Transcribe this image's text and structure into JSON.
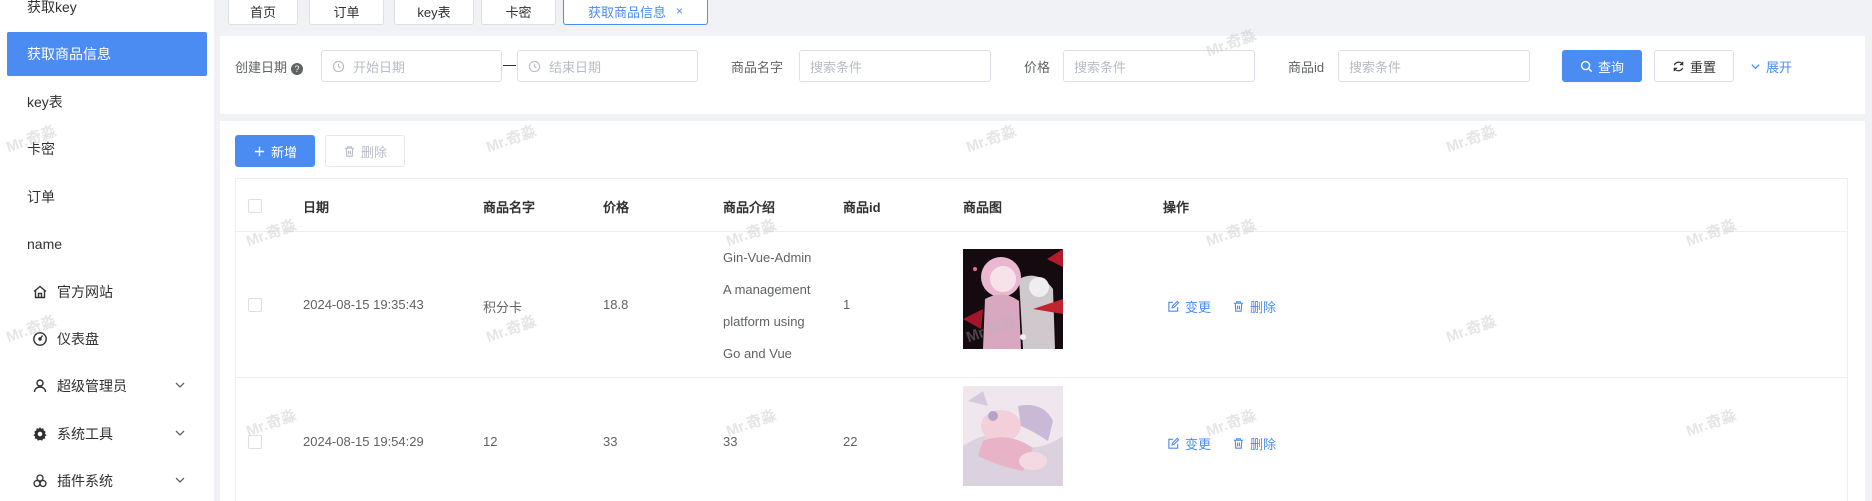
{
  "sidebar": {
    "items": [
      {
        "label": "获取key"
      },
      {
        "label": "获取商品信息"
      },
      {
        "label": "key表"
      },
      {
        "label": "卡密"
      },
      {
        "label": "订单"
      },
      {
        "label": "name"
      },
      {
        "label": "官方网站",
        "icon": "home-icon"
      },
      {
        "label": "仪表盘",
        "icon": "dashboard-icon"
      },
      {
        "label": "超级管理员",
        "icon": "user-icon"
      },
      {
        "label": "系统工具",
        "icon": "gear-icon"
      },
      {
        "label": "插件系统",
        "icon": "plugin-icon"
      }
    ]
  },
  "tabs": [
    {
      "label": "首页"
    },
    {
      "label": "订单"
    },
    {
      "label": "key表"
    },
    {
      "label": "卡密"
    },
    {
      "label": "获取商品信息",
      "close": "×"
    }
  ],
  "search": {
    "created_label": "创建日期",
    "help_mark": "?",
    "start_placeholder": "开始日期",
    "end_placeholder": "结束日期",
    "name_label": "商品名字",
    "name_placeholder": "搜索条件",
    "price_label": "价格",
    "price_placeholder": "搜索条件",
    "id_label": "商品id",
    "id_placeholder": "搜索条件",
    "query_label": "查询",
    "reset_label": "重置",
    "expand_label": "展开"
  },
  "toolbar": {
    "add_label": "新增",
    "delete_label": "删除"
  },
  "table": {
    "columns": [
      "日期",
      "商品名字",
      "价格",
      "商品介绍",
      "商品id",
      "商品图",
      "操作"
    ],
    "rows": [
      {
        "date": "2024-08-15 19:35:43",
        "name": "积分卡",
        "price": "18.8",
        "desc_lines": [
          "Gin-Vue-Admin",
          "A management",
          "platform using",
          "Go and Vue"
        ],
        "id": "1",
        "edit": "变更",
        "delete": "删除"
      },
      {
        "date": "2024-08-15 19:54:29",
        "name": "12",
        "price": "33",
        "desc_lines": [
          "33"
        ],
        "id": "22",
        "edit": "变更",
        "delete": "删除"
      }
    ]
  },
  "watermark": "Mr.奇淼",
  "colors": {
    "primary": "#4a8cf2",
    "background": "#f0f2f5"
  }
}
